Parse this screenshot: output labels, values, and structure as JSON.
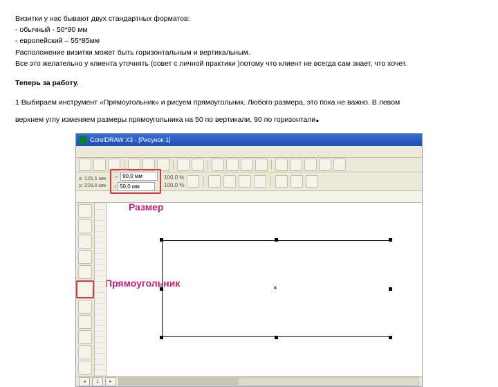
{
  "text": {
    "l1": "Визитки у нас бывают двух стандартных форматов:",
    "l2": "- обычный - 50*90 мм",
    "l3": "- европейский – 55*85мм",
    "l4": "Расположение визитки может быть горизонтальным и вертикальным.",
    "l5": "Все это желательно у клиента уточнять (совет с личной практики  )потому что клиент не всегда сам знает, что хочет.",
    "l6": "Теперь за работу.",
    "l7a": "1 Выбираем инструмент «Прямоугольник» и рисуем прямоугольник. Любого размера, это пока не важно. В левом",
    "l7b": "верхнем углу изменяем размеры прямоугольника на 50 по вертикали, 90 по горизонтали",
    "l7c": "."
  },
  "app": {
    "title": "CorelDRAW X3 - [Рисунок 1]",
    "coords": {
      "x": "x: 125,5 мм",
      "y": "y: 228,0 мм"
    },
    "size": {
      "w": "90,0 мм",
      "h": "50,0 мм"
    },
    "percent": {
      "w": "100,0  %",
      "h": "100,0  %"
    },
    "ann_size": "Размер",
    "ann_rect": "Прямоугольник",
    "nav": {
      "left": "◂",
      "right": "▸",
      "page": "1"
    }
  }
}
